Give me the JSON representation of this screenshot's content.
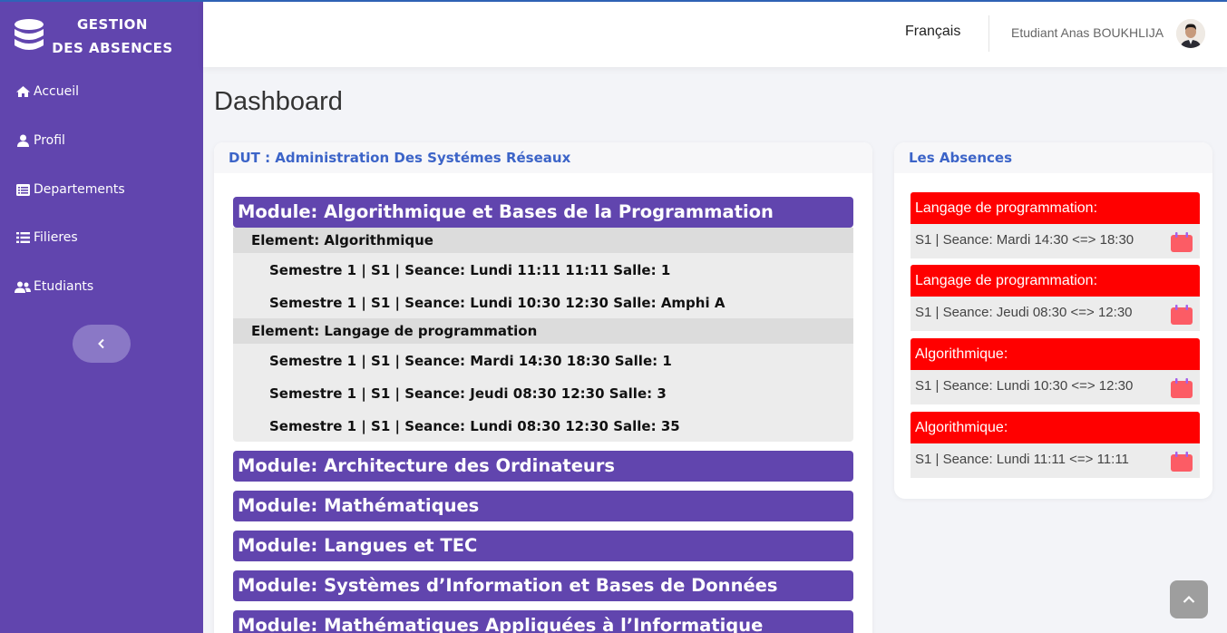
{
  "brand": {
    "line1": "GESTION",
    "line2": "DES ABSENCES",
    "icon": "database-icon"
  },
  "sidebar": {
    "items": [
      {
        "label": "Accueil",
        "icon": "home-icon"
      },
      {
        "label": "Profil",
        "icon": "user-icon"
      },
      {
        "label": "Departements",
        "icon": "list-alt-icon"
      },
      {
        "label": "Filieres",
        "icon": "list-icon"
      },
      {
        "label": "Etudiants",
        "icon": "users-icon"
      }
    ],
    "collapse_icon": "chevron-left-icon"
  },
  "topbar": {
    "language": "Français",
    "user_name": "Etudiant Anas BOUKHLIJA"
  },
  "page": {
    "title": "Dashboard"
  },
  "formation": {
    "title": "DUT : Administration Des Systémes Réseaux",
    "modules": [
      {
        "label": "Module: Algorithmique et Bases de la Programmation",
        "elements": [
          {
            "label": "Element: Algorithmique",
            "seances": [
              "Semestre 1 | S1 | Seance: Lundi 11:11 11:11 Salle: 1",
              "Semestre 1 | S1 | Seance: Lundi 10:30 12:30 Salle: Amphi A"
            ]
          },
          {
            "label": "Element: Langage de programmation",
            "seances": [
              "Semestre 1 | S1 | Seance: Mardi 14:30 18:30 Salle: 1",
              "Semestre 1 | S1 | Seance: Jeudi 08:30 12:30 Salle: 3",
              "Semestre 1 | S1 | Seance: Lundi 08:30 12:30 Salle: 35"
            ]
          }
        ]
      },
      {
        "label": "Module: Architecture des Ordinateurs"
      },
      {
        "label": "Module: Mathématiques"
      },
      {
        "label": "Module: Langues et TEC"
      },
      {
        "label": "Module: Systèmes d’Information et Bases de Données"
      },
      {
        "label": "Module: Mathématiques Appliquées à l’Informatique"
      }
    ]
  },
  "absences": {
    "title": "Les Absences",
    "items": [
      {
        "title": "Langage de programmation:",
        "detail": "S1 | Seance: Mardi 14:30 <=> 18:30"
      },
      {
        "title": "Langage de programmation:",
        "detail": "S1 | Seance: Jeudi 08:30 <=> 12:30"
      },
      {
        "title": "Algorithmique:",
        "detail": "S1 | Seance: Lundi 10:30 <=> 12:30"
      },
      {
        "title": "Algorithmique:",
        "detail": "S1 | Seance: Lundi 11:11 <=> 11:11"
      }
    ],
    "icon": "calendar-icon"
  },
  "colors": {
    "sidebar": "#6145ae",
    "module": "#6145ae",
    "absence": "#ff0000",
    "link": "#3c64c8"
  }
}
